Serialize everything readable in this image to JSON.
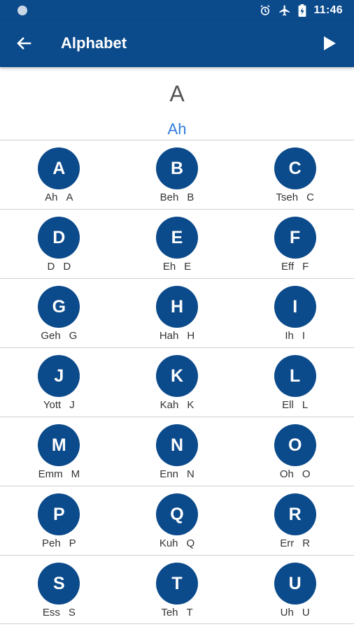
{
  "status": {
    "time": "11:46",
    "icons": [
      "alarm-icon",
      "airplane-icon",
      "battery-charging-icon"
    ]
  },
  "appbar": {
    "title": "Alphabet",
    "back_icon": "arrow-left-icon",
    "play_icon": "play-icon"
  },
  "current": {
    "letter": "A",
    "pronunciation": "Ah"
  },
  "colors": {
    "primary": "#0b4a8b",
    "accent_text": "#2f7bdc"
  },
  "rows": [
    [
      {
        "letter": "A",
        "name": "Ah",
        "latin": "A"
      },
      {
        "letter": "B",
        "name": "Beh",
        "latin": "B"
      },
      {
        "letter": "C",
        "name": "Tseh",
        "latin": "C"
      }
    ],
    [
      {
        "letter": "D",
        "name": "D",
        "latin": "D"
      },
      {
        "letter": "E",
        "name": "Eh",
        "latin": "E"
      },
      {
        "letter": "F",
        "name": "Eff",
        "latin": "F"
      }
    ],
    [
      {
        "letter": "G",
        "name": "Geh",
        "latin": "G"
      },
      {
        "letter": "H",
        "name": "Hah",
        "latin": "H"
      },
      {
        "letter": "I",
        "name": "Ih",
        "latin": "I"
      }
    ],
    [
      {
        "letter": "J",
        "name": "Yott",
        "latin": "J"
      },
      {
        "letter": "K",
        "name": "Kah",
        "latin": "K"
      },
      {
        "letter": "L",
        "name": "Ell",
        "latin": "L"
      }
    ],
    [
      {
        "letter": "M",
        "name": "Emm",
        "latin": "M"
      },
      {
        "letter": "N",
        "name": "Enn",
        "latin": "N"
      },
      {
        "letter": "O",
        "name": "Oh",
        "latin": "O"
      }
    ],
    [
      {
        "letter": "P",
        "name": "Peh",
        "latin": "P"
      },
      {
        "letter": "Q",
        "name": "Kuh",
        "latin": "Q"
      },
      {
        "letter": "R",
        "name": "Err",
        "latin": "R"
      }
    ],
    [
      {
        "letter": "S",
        "name": "Ess",
        "latin": "S"
      },
      {
        "letter": "T",
        "name": "Teh",
        "latin": "T"
      },
      {
        "letter": "U",
        "name": "Uh",
        "latin": "U"
      }
    ]
  ]
}
